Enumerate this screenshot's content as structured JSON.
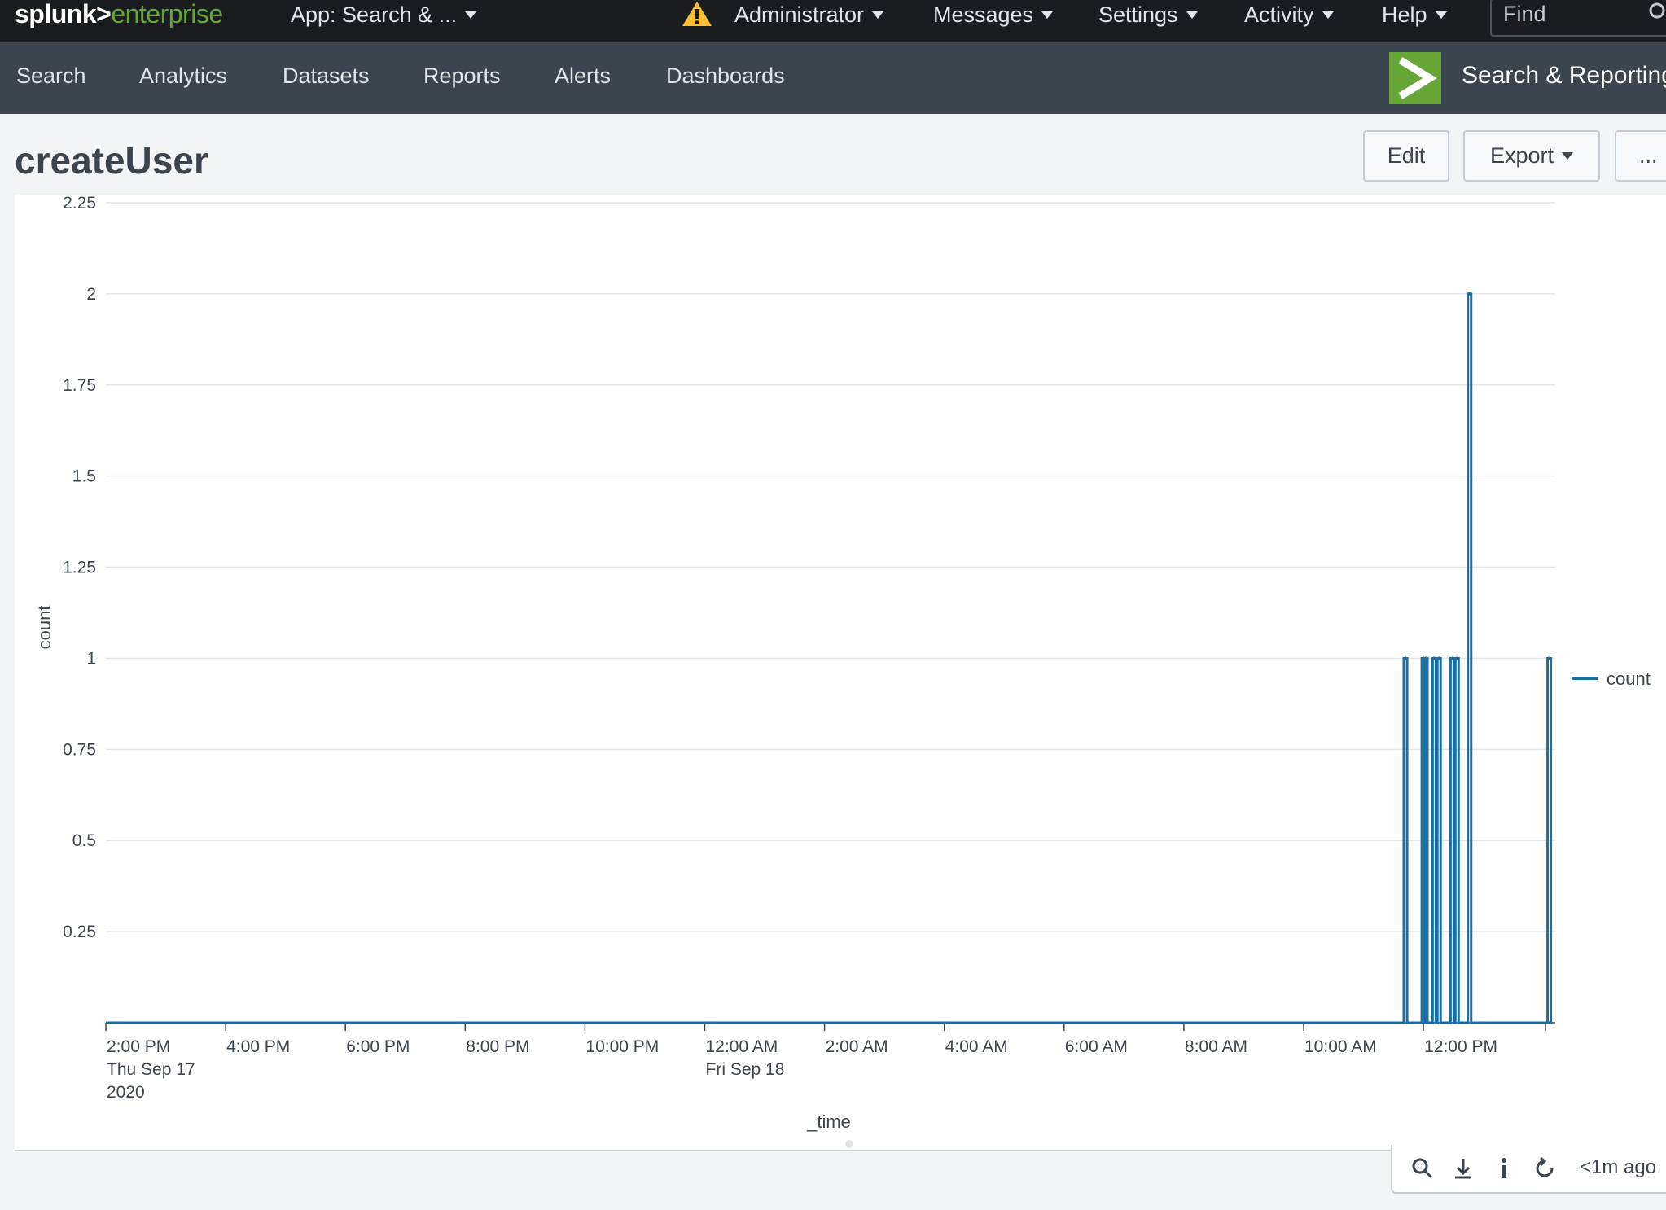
{
  "header": {
    "brand_primary": "splunk>",
    "brand_secondary": "enterprise",
    "app_menu": "App: Search & ...",
    "menus": [
      {
        "label": "Administrator"
      },
      {
        "label": "Messages"
      },
      {
        "label": "Settings"
      },
      {
        "label": "Activity"
      },
      {
        "label": "Help"
      }
    ],
    "find_placeholder": "Find",
    "warning_icon": "warning-triangle-icon",
    "colors": {
      "brand_green": "#65a637",
      "bar_bg": "#1a1c20"
    }
  },
  "nav": {
    "items": [
      {
        "label": "Search"
      },
      {
        "label": "Analytics"
      },
      {
        "label": "Datasets"
      },
      {
        "label": "Reports"
      },
      {
        "label": "Alerts"
      },
      {
        "label": "Dashboards"
      }
    ],
    "app_title": "Search & Reporting",
    "colors": {
      "bar_bg": "#3c444d"
    }
  },
  "page": {
    "title": "createUser",
    "buttons": {
      "edit": "Edit",
      "export": "Export",
      "more": "..."
    }
  },
  "chart_data": {
    "type": "line",
    "title": "",
    "xlabel": "_time",
    "ylabel": "count",
    "ylim": [
      0,
      2.25
    ],
    "y_ticks": [
      "2.25",
      "2",
      "1.75",
      "1.5",
      "1.25",
      "1",
      "0.75",
      "0.5",
      "0.25"
    ],
    "x_ticks": [
      {
        "lines": [
          "2:00 PM",
          "Thu Sep 17",
          "2020"
        ]
      },
      {
        "lines": [
          "4:00 PM"
        ]
      },
      {
        "lines": [
          "6:00 PM"
        ]
      },
      {
        "lines": [
          "8:00 PM"
        ]
      },
      {
        "lines": [
          "10:00 PM"
        ]
      },
      {
        "lines": [
          "12:00 AM",
          "Fri Sep 18"
        ]
      },
      {
        "lines": [
          "2:00 AM"
        ]
      },
      {
        "lines": [
          "4:00 AM"
        ]
      },
      {
        "lines": [
          "6:00 AM"
        ]
      },
      {
        "lines": [
          "8:00 AM"
        ]
      },
      {
        "lines": [
          "10:00 AM"
        ]
      },
      {
        "lines": [
          "12:00 PM"
        ]
      }
    ],
    "x_range_hours": [
      0,
      24.17
    ],
    "grid": true,
    "legend": {
      "position": "right",
      "entries": [
        "count"
      ]
    },
    "series": [
      {
        "name": "count",
        "color": "#1a6ea0",
        "points": [
          {
            "t": 21.7,
            "v": 1
          },
          {
            "t": 22.0,
            "v": 1
          },
          {
            "t": 22.04,
            "v": 1
          },
          {
            "t": 22.18,
            "v": 1
          },
          {
            "t": 22.26,
            "v": 1
          },
          {
            "t": 22.48,
            "v": 1
          },
          {
            "t": 22.56,
            "v": 1
          },
          {
            "t": 22.77,
            "v": 2
          },
          {
            "t": 24.1,
            "v": 1
          }
        ]
      }
    ]
  },
  "footer": {
    "icons": [
      "search-icon",
      "download-icon",
      "info-icon",
      "refresh-icon"
    ],
    "status": "<1m ago"
  }
}
